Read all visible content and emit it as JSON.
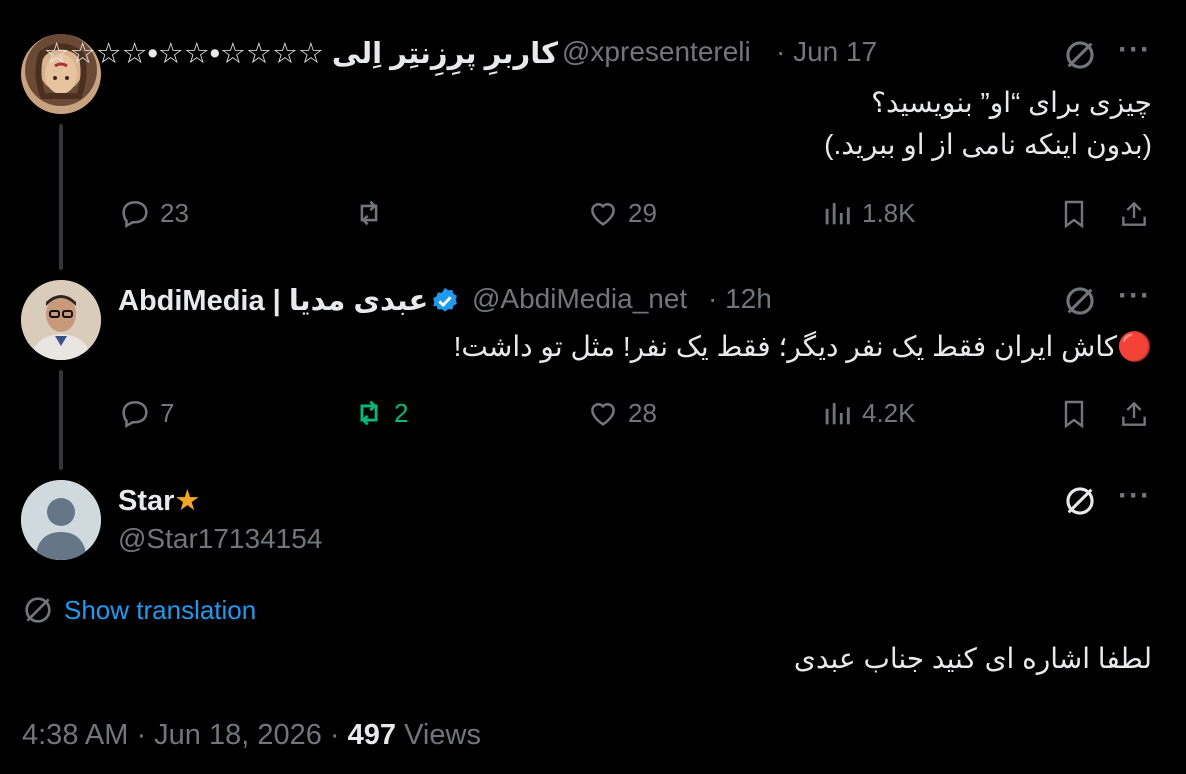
{
  "tweets": [
    {
      "display_name": "کاربرِ پرِزِنتِر اِلی ☆☆☆☆•☆☆•☆☆☆☆",
      "handle": "@xpresentereli",
      "time": "· Jun 17",
      "text_line1": "چیزی برای “او” بنویسید؟",
      "text_line2": "(بدون اینکه نامی از او ببرید.)",
      "replies": "23",
      "reposts": "",
      "likes": "29",
      "views": "1.8K"
    },
    {
      "display_name": "AbdiMedia | عبدی مدیا",
      "handle": "@AbdiMedia_net",
      "time": "· 12h",
      "text": "🔴کاش ایران فقط یک نفر دیگر؛ فقط یک نفر! مثل تو داشت!",
      "replies": "7",
      "reposts": "2",
      "likes": "28",
      "views": "4.2K"
    }
  ],
  "main_tweet": {
    "display_name": "Star",
    "handle": "@Star17134154",
    "show_translation": "Show translation",
    "text": "لطفا اشاره ای کنید جناب عبدی",
    "timestamp": "4:38 AM · Jun 18, 2026 ·",
    "views_count": "497",
    "views_label": "Views"
  },
  "colors": {
    "background": "#000000",
    "text": "#e7e9ea",
    "muted": "#71767b",
    "accent": "#1d9bf0",
    "repost_active": "#00ba7c"
  }
}
